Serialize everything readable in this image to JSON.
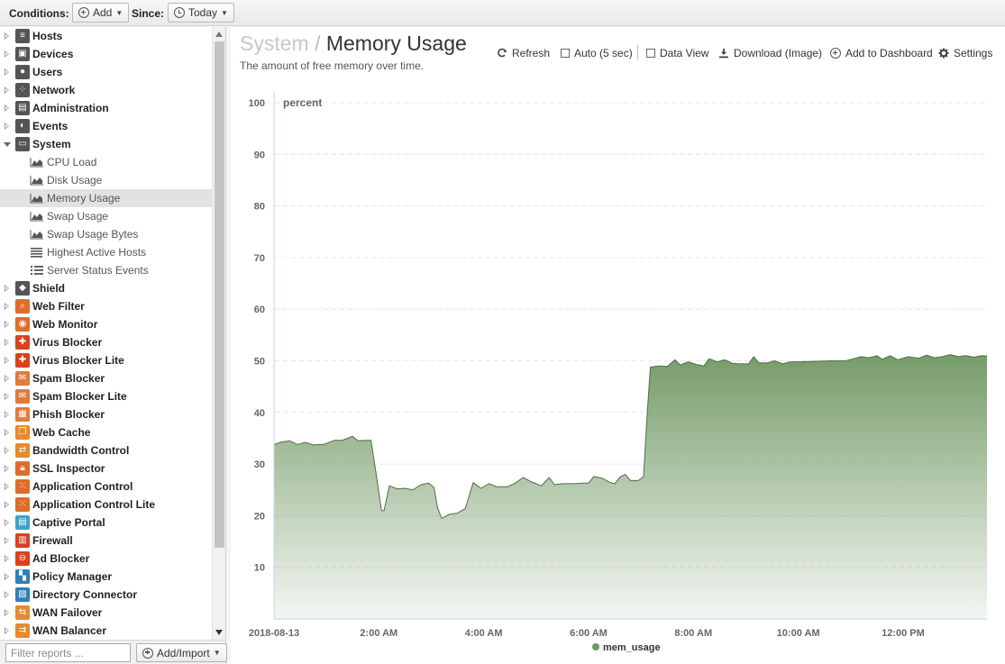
{
  "toolbar": {
    "conditions_label": "Conditions:",
    "add_label": "Add",
    "since_label": "Since:",
    "since_value": "Today"
  },
  "sidebar": {
    "categories": [
      {
        "label": "Hosts",
        "icon": "hosts-icon",
        "color": "#555555",
        "expanded": false
      },
      {
        "label": "Devices",
        "icon": "devices-icon",
        "color": "#555555",
        "expanded": false
      },
      {
        "label": "Users",
        "icon": "users-icon",
        "color": "#555555",
        "expanded": false
      },
      {
        "label": "Network",
        "icon": "network-icon",
        "color": "#555555",
        "expanded": false
      },
      {
        "label": "Administration",
        "icon": "administration-icon",
        "color": "#555555",
        "expanded": false
      },
      {
        "label": "Events",
        "icon": "events-icon",
        "color": "#555555",
        "expanded": false
      },
      {
        "label": "System",
        "icon": "system-icon",
        "color": "#555555",
        "expanded": true,
        "children": [
          {
            "label": "CPU Load",
            "icon": "area-chart-icon"
          },
          {
            "label": "Disk Usage",
            "icon": "area-chart-icon"
          },
          {
            "label": "Memory Usage",
            "icon": "area-chart-icon",
            "selected": true
          },
          {
            "label": "Swap Usage",
            "icon": "area-chart-icon"
          },
          {
            "label": "Swap Usage Bytes",
            "icon": "area-chart-icon"
          },
          {
            "label": "Highest Active Hosts",
            "icon": "text-list-icon"
          },
          {
            "label": "Server Status Events",
            "icon": "list-icon"
          }
        ]
      },
      {
        "label": "Shield",
        "icon": "shield-icon",
        "color": "#555555",
        "expanded": false
      },
      {
        "label": "Web Filter",
        "icon": "web-filter-icon",
        "color": "#e06c2a",
        "expanded": false
      },
      {
        "label": "Web Monitor",
        "icon": "web-monitor-icon",
        "color": "#e06c2a",
        "expanded": false
      },
      {
        "label": "Virus Blocker",
        "icon": "virus-blocker-icon",
        "color": "#d9421d",
        "expanded": false
      },
      {
        "label": "Virus Blocker Lite",
        "icon": "virus-blocker-lite-icon",
        "color": "#d9421d",
        "expanded": false
      },
      {
        "label": "Spam Blocker",
        "icon": "spam-blocker-icon",
        "color": "#e27a3c",
        "expanded": false
      },
      {
        "label": "Spam Blocker Lite",
        "icon": "spam-blocker-lite-icon",
        "color": "#e27a3c",
        "expanded": false
      },
      {
        "label": "Phish Blocker",
        "icon": "phish-blocker-icon",
        "color": "#e27a3c",
        "expanded": false
      },
      {
        "label": "Web Cache",
        "icon": "web-cache-icon",
        "color": "#e8892e",
        "expanded": false
      },
      {
        "label": "Bandwidth Control",
        "icon": "bandwidth-control-icon",
        "color": "#e8892e",
        "expanded": false
      },
      {
        "label": "SSL Inspector",
        "icon": "ssl-inspector-icon",
        "color": "#e06c2a",
        "expanded": false
      },
      {
        "label": "Application Control",
        "icon": "application-control-icon",
        "color": "#e06c2a",
        "expanded": false
      },
      {
        "label": "Application Control Lite",
        "icon": "application-control-lite-icon",
        "color": "#e06c2a",
        "expanded": false
      },
      {
        "label": "Captive Portal",
        "icon": "captive-portal-icon",
        "color": "#3aa5c8",
        "expanded": false
      },
      {
        "label": "Firewall",
        "icon": "firewall-icon",
        "color": "#d9421d",
        "expanded": false
      },
      {
        "label": "Ad Blocker",
        "icon": "ad-blocker-icon",
        "color": "#d9421d",
        "expanded": false
      },
      {
        "label": "Policy Manager",
        "icon": "policy-manager-icon",
        "color": "#2f7fb8",
        "expanded": false
      },
      {
        "label": "Directory Connector",
        "icon": "directory-connector-icon",
        "color": "#2f7fb8",
        "expanded": false
      },
      {
        "label": "WAN Failover",
        "icon": "wan-failover-icon",
        "color": "#e8892e",
        "expanded": false
      },
      {
        "label": "WAN Balancer",
        "icon": "wan-balancer-icon",
        "color": "#e8892e",
        "expanded": false
      }
    ]
  },
  "footer": {
    "filter_placeholder": "Filter reports ...",
    "add_import_label": "Add/Import"
  },
  "report": {
    "category": "System",
    "separator": "/",
    "title": "Memory Usage",
    "description": "The amount of free memory over time.",
    "actions": {
      "refresh": "Refresh",
      "auto": "Auto (5 sec)",
      "data_view": "Data View",
      "download": "Download (Image)",
      "add_to_dashboard": "Add to Dashboard",
      "settings": "Settings"
    }
  },
  "chart_data": {
    "type": "area",
    "title": "",
    "ylabel": "percent",
    "xlabel": "",
    "ylim": [
      0,
      100
    ],
    "yticks": [
      10,
      20,
      30,
      40,
      50,
      60,
      70,
      80,
      90,
      100
    ],
    "xlim": [
      0,
      13.6
    ],
    "xticks": [
      {
        "x": 0,
        "label": "2018-08-13"
      },
      {
        "x": 2,
        "label": "2:00 AM"
      },
      {
        "x": 4,
        "label": "4:00 AM"
      },
      {
        "x": 6,
        "label": "6:00 AM"
      },
      {
        "x": 8,
        "label": "8:00 AM"
      },
      {
        "x": 10,
        "label": "10:00 AM"
      },
      {
        "x": 12,
        "label": "12:00 PM"
      }
    ],
    "grid": true,
    "legend_position": "bottom-center",
    "color": "#6f9762",
    "series": [
      {
        "name": "mem_usage",
        "points": [
          [
            0.0,
            33.8
          ],
          [
            0.15,
            34.3
          ],
          [
            0.3,
            34.5
          ],
          [
            0.45,
            33.8
          ],
          [
            0.6,
            34.2
          ],
          [
            0.75,
            33.7
          ],
          [
            0.95,
            33.8
          ],
          [
            1.15,
            34.6
          ],
          [
            1.3,
            34.6
          ],
          [
            1.5,
            35.4
          ],
          [
            1.6,
            34.5
          ],
          [
            1.75,
            34.6
          ],
          [
            1.85,
            34.6
          ],
          [
            1.95,
            28.0
          ],
          [
            2.05,
            21.0
          ],
          [
            2.1,
            21.0
          ],
          [
            2.2,
            25.8
          ],
          [
            2.35,
            25.2
          ],
          [
            2.5,
            25.3
          ],
          [
            2.65,
            25.0
          ],
          [
            2.8,
            26.0
          ],
          [
            2.95,
            26.3
          ],
          [
            3.05,
            25.5
          ],
          [
            3.12,
            21.5
          ],
          [
            3.2,
            19.5
          ],
          [
            3.35,
            20.3
          ],
          [
            3.5,
            20.5
          ],
          [
            3.65,
            21.4
          ],
          [
            3.8,
            26.4
          ],
          [
            3.95,
            25.3
          ],
          [
            4.1,
            26.2
          ],
          [
            4.25,
            25.6
          ],
          [
            4.45,
            25.6
          ],
          [
            4.6,
            26.3
          ],
          [
            4.75,
            27.4
          ],
          [
            4.9,
            26.6
          ],
          [
            5.0,
            26.2
          ],
          [
            5.1,
            25.8
          ],
          [
            5.25,
            27.4
          ],
          [
            5.35,
            26.0
          ],
          [
            5.5,
            26.2
          ],
          [
            5.7,
            26.2
          ],
          [
            5.9,
            26.3
          ],
          [
            6.0,
            26.3
          ],
          [
            6.1,
            27.6
          ],
          [
            6.25,
            27.3
          ],
          [
            6.4,
            26.5
          ],
          [
            6.5,
            26.2
          ],
          [
            6.6,
            27.5
          ],
          [
            6.7,
            28.0
          ],
          [
            6.8,
            26.8
          ],
          [
            6.95,
            26.8
          ],
          [
            7.05,
            27.6
          ],
          [
            7.12,
            40.0
          ],
          [
            7.18,
            48.8
          ],
          [
            7.35,
            49.0
          ],
          [
            7.5,
            48.9
          ],
          [
            7.65,
            50.2
          ],
          [
            7.75,
            49.2
          ],
          [
            7.9,
            49.8
          ],
          [
            8.05,
            49.3
          ],
          [
            8.2,
            49.0
          ],
          [
            8.3,
            50.4
          ],
          [
            8.45,
            49.8
          ],
          [
            8.6,
            50.2
          ],
          [
            8.75,
            49.5
          ],
          [
            8.9,
            49.4
          ],
          [
            9.05,
            49.4
          ],
          [
            9.15,
            50.8
          ],
          [
            9.25,
            49.6
          ],
          [
            9.4,
            49.6
          ],
          [
            9.55,
            50.0
          ],
          [
            9.7,
            49.4
          ],
          [
            9.85,
            49.8
          ],
          [
            10.0,
            49.8
          ],
          [
            10.3,
            49.9
          ],
          [
            10.6,
            50.0
          ],
          [
            10.9,
            50.0
          ],
          [
            11.05,
            50.4
          ],
          [
            11.2,
            50.8
          ],
          [
            11.35,
            50.6
          ],
          [
            11.5,
            51.0
          ],
          [
            11.6,
            50.3
          ],
          [
            11.75,
            51.0
          ],
          [
            11.9,
            50.2
          ],
          [
            12.1,
            50.8
          ],
          [
            12.3,
            50.5
          ],
          [
            12.45,
            51.1
          ],
          [
            12.6,
            50.6
          ],
          [
            12.75,
            50.8
          ],
          [
            12.9,
            51.2
          ],
          [
            13.05,
            50.8
          ],
          [
            13.2,
            51.0
          ],
          [
            13.35,
            50.7
          ],
          [
            13.5,
            51.0
          ],
          [
            13.6,
            50.9
          ]
        ]
      }
    ]
  }
}
